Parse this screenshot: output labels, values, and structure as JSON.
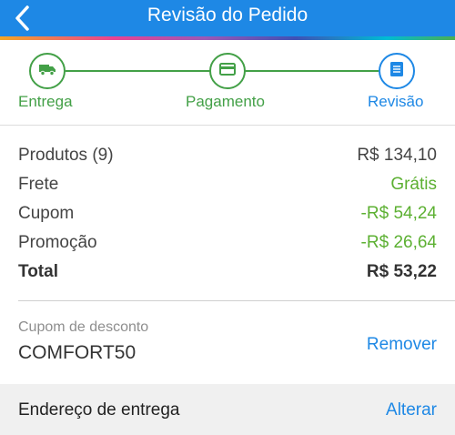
{
  "header": {
    "title": "Revisão do Pedido",
    "back_icon": "chevron-left-icon"
  },
  "stepper": {
    "steps": [
      {
        "label": "Entrega",
        "icon": "truck-icon",
        "state": "done"
      },
      {
        "label": "Pagamento",
        "icon": "credit-card-icon",
        "state": "done"
      },
      {
        "label": "Revisão",
        "icon": "list-icon",
        "state": "active"
      }
    ]
  },
  "summary": {
    "rows": [
      {
        "label": "Produtos (9)",
        "value": "R$ 134,10"
      },
      {
        "label": "Frete",
        "value": "Grátis"
      },
      {
        "label": "Cupom",
        "value": "-R$ 54,24"
      },
      {
        "label": "Promoção",
        "value": "-R$ 26,64"
      },
      {
        "label": "Total",
        "value": "R$ 53,22"
      }
    ]
  },
  "coupon": {
    "caption": "Cupom de desconto",
    "code": "COMFORT50",
    "remove_label": "Remover"
  },
  "address": {
    "label": "Endereço de entrega",
    "change_label": "Alterar"
  },
  "colors": {
    "primary": "#1e88e5",
    "success": "#43a047",
    "discount": "#5cb032"
  }
}
